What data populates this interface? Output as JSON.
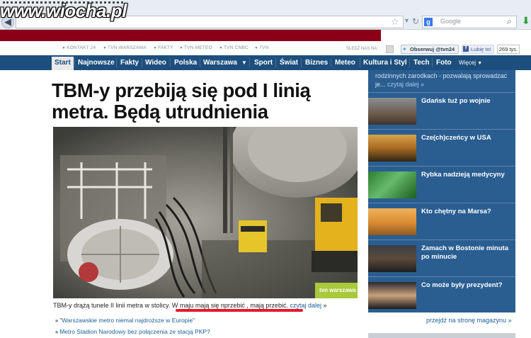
{
  "watermark": "www.wiocha.pl",
  "browser": {
    "search_placeholder": "Google"
  },
  "top_links": [
    "KONTAKT 24",
    "TVN WARSZAWA",
    "FAKTY",
    "TVN METEO",
    "TVN CNBC",
    "TVN"
  ],
  "social": {
    "follow_label": "ŚLEDŹ NAS NA:",
    "twitter_label": "Obserwuj @tvn24",
    "like_label": "Lubię to!",
    "like_count": "269 tys."
  },
  "nav": {
    "items": [
      "Start",
      "Najnowsze",
      "Fakty",
      "Wideo",
      "Polska",
      "Warszawa",
      "Sport",
      "Świat",
      "Biznes",
      "Meteo",
      "Kultura i Styl",
      "Tech",
      "Foto",
      "Więcej"
    ],
    "active": "Start"
  },
  "article": {
    "headline": "TBM-y przebiją się pod I linią metra. Będą utrudnienia",
    "photo_badge": "tvn warszawa",
    "caption_start": "TBM-y drążą tunele II linii metra w stolicy. ",
    "caption_highlight": "W maju mają się nprzebić , mają przebić.",
    "caption_link": "czytaj dalej",
    "caption_arrow": "»",
    "related": [
      "\"Warszawskie metro niemal najdroższe w Europie\"",
      "Metro Stadion Narodowy bez połączenia ze stacją PKP?"
    ]
  },
  "sidebar": {
    "intro_text": "rodzinnych zarodkach - pozwalają sprowadzać je...",
    "intro_link": "czytaj dalej »",
    "items": [
      {
        "title": "Gdańsk tuż po wojnie"
      },
      {
        "title": "Cze(ch)czeńcy w USA"
      },
      {
        "title": "Rybka nadzieją medycyny"
      },
      {
        "title": "Kto chętny na Marsa?"
      },
      {
        "title": "Zamach w Bostonie minuta po minucie"
      },
      {
        "title": "Co może były prezydent?"
      }
    ],
    "magazine_link": "przejdź na stronę magazynu »"
  },
  "colors": {
    "brand_red": "#8b0016",
    "nav_blue": "#1c4f7d",
    "sidebar_blue": "#2a5e91",
    "link_blue": "#1c5f9b",
    "underline_red": "#e8192c"
  }
}
